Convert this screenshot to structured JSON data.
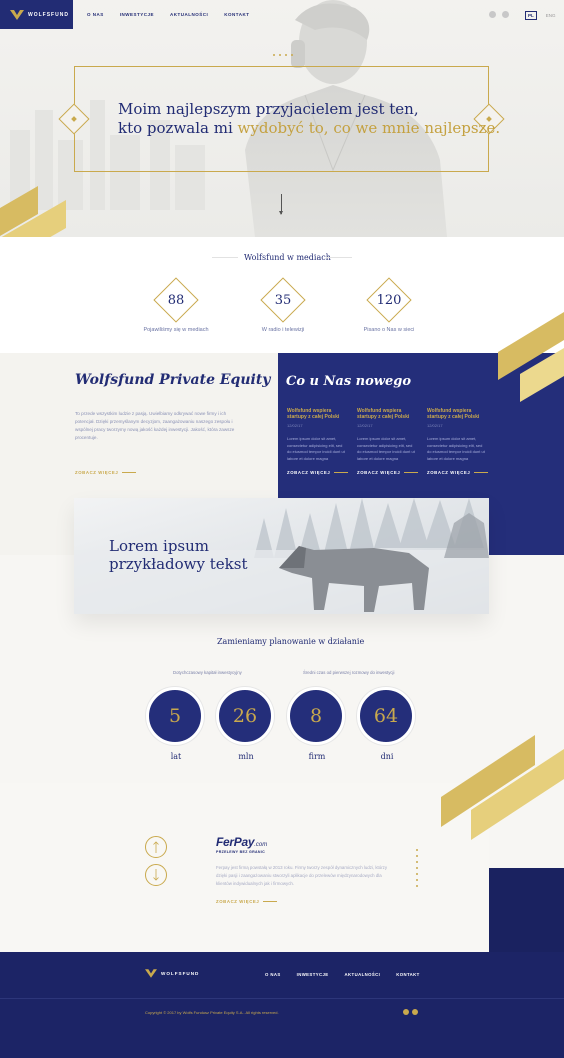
{
  "header": {
    "brand": "WOLFSFUND",
    "nav": [
      "O NAS",
      "INWESTYCJE",
      "AKTUALNOŚCI",
      "KONTAKT"
    ],
    "lang_active": "PL",
    "lang_other": "ENG",
    "social_icons": [
      "instagram-icon",
      "twitter-icon"
    ]
  },
  "hero": {
    "line1": "Moim najlepszym przyjacielem jest ten,",
    "line2_plain": "kto pozwala mi ",
    "line2_gold": "wydobyć to, co we mnie najlepsze."
  },
  "media": {
    "title": "Wolfsfund w mediach",
    "stats": [
      {
        "value": "88",
        "label": "Pojawiliśmy się w mediach"
      },
      {
        "value": "35",
        "label": "W radio i telewizji"
      },
      {
        "value": "120",
        "label": "Pisano o Nas w sieci"
      }
    ]
  },
  "pe": {
    "title": "Wolfsfund Private Equity",
    "text": "To przede wszystkim ludzie z pasją. Uwielbiamy odkrywać nowe firmy i ich potencjał. Dzięki przemyślanym decyzjom, zaangażowaniu naszego zespołu i wspólnej pracy tworzymy nową jakość każdej inwestycji. Jakość, która zawsze procentuje.",
    "more": "ZOBACZ WIĘCEJ"
  },
  "news": {
    "title": "Co u Nas nowego",
    "items": [
      {
        "headline": "Wolfsfund wspiera startupy z całej Polski",
        "date": "12/02/17",
        "text": "Lorem ipsum dolor sit amet, consectetur adipisicing elit, sed do eiusmod tempor incidi dunt ut labore et dolore magna",
        "more": "ZOBACZ WIĘCEJ"
      },
      {
        "headline": "Wolfsfund wspiera startupy z całej Polski",
        "date": "12/02/17",
        "text": "Lorem ipsum dolor sit amet, consectetur adipisicing elit, sed do eiusmod tempor incidi dunt ut labore et dolore magna",
        "more": "ZOBACZ WIĘCEJ"
      },
      {
        "headline": "Wolfsfund wspiera startupy z całej Polski",
        "date": "12/02/17",
        "text": "Lorem ipsum dolor sit amet, consectetur adipisicing elit, sed do eiusmod tempor incidi dunt ut labore et dolore magna",
        "more": "ZOBACZ WIĘCEJ"
      }
    ]
  },
  "banner": {
    "line1": "Lorem ipsum",
    "line2": "przykładowy tekst"
  },
  "plan": {
    "title": "Zamieniamy planowanie w działanie",
    "label_left": "Dotychczasowy kapitał inwestycyjny",
    "label_right": "Średni czas od pierwszej rozmowy do inwestycji",
    "figures": [
      {
        "value": "5",
        "unit": "lat"
      },
      {
        "value": "26",
        "unit": "mln"
      },
      {
        "value": "8",
        "unit": "firm"
      },
      {
        "value": "64",
        "unit": "dni"
      }
    ]
  },
  "ferpay": {
    "logo": "FerPay",
    "logo_suffix": ".com",
    "tagline": "PRZELEWY BEZ GRANIC",
    "text": "Ferpay jest firmą powstałą w 2013 roku. Firmy tworzy zespół dynamicznych ludzi, którzy dzięki pasji i zaangażowaniu stworzyli aplikacje do przelewów międzynarodowych dla klientów indywidualnych jak i firmowych.",
    "more": "ZOBACZ WIĘCEJ"
  },
  "footer": {
    "brand": "WOLFSFUND",
    "nav": [
      "O NAS",
      "INWESTYCJE",
      "AKTUALNOŚCI",
      "KONTAKT"
    ],
    "copyright": "Copyright © 2017 by Wolfs Fundusz Private Equity S.A.. All rights reserved.",
    "social_icons": [
      "facebook-icon",
      "twitter-icon"
    ]
  },
  "colors": {
    "navy": "#222c74",
    "gold": "#c9a94d",
    "footer": "#1c2466"
  }
}
